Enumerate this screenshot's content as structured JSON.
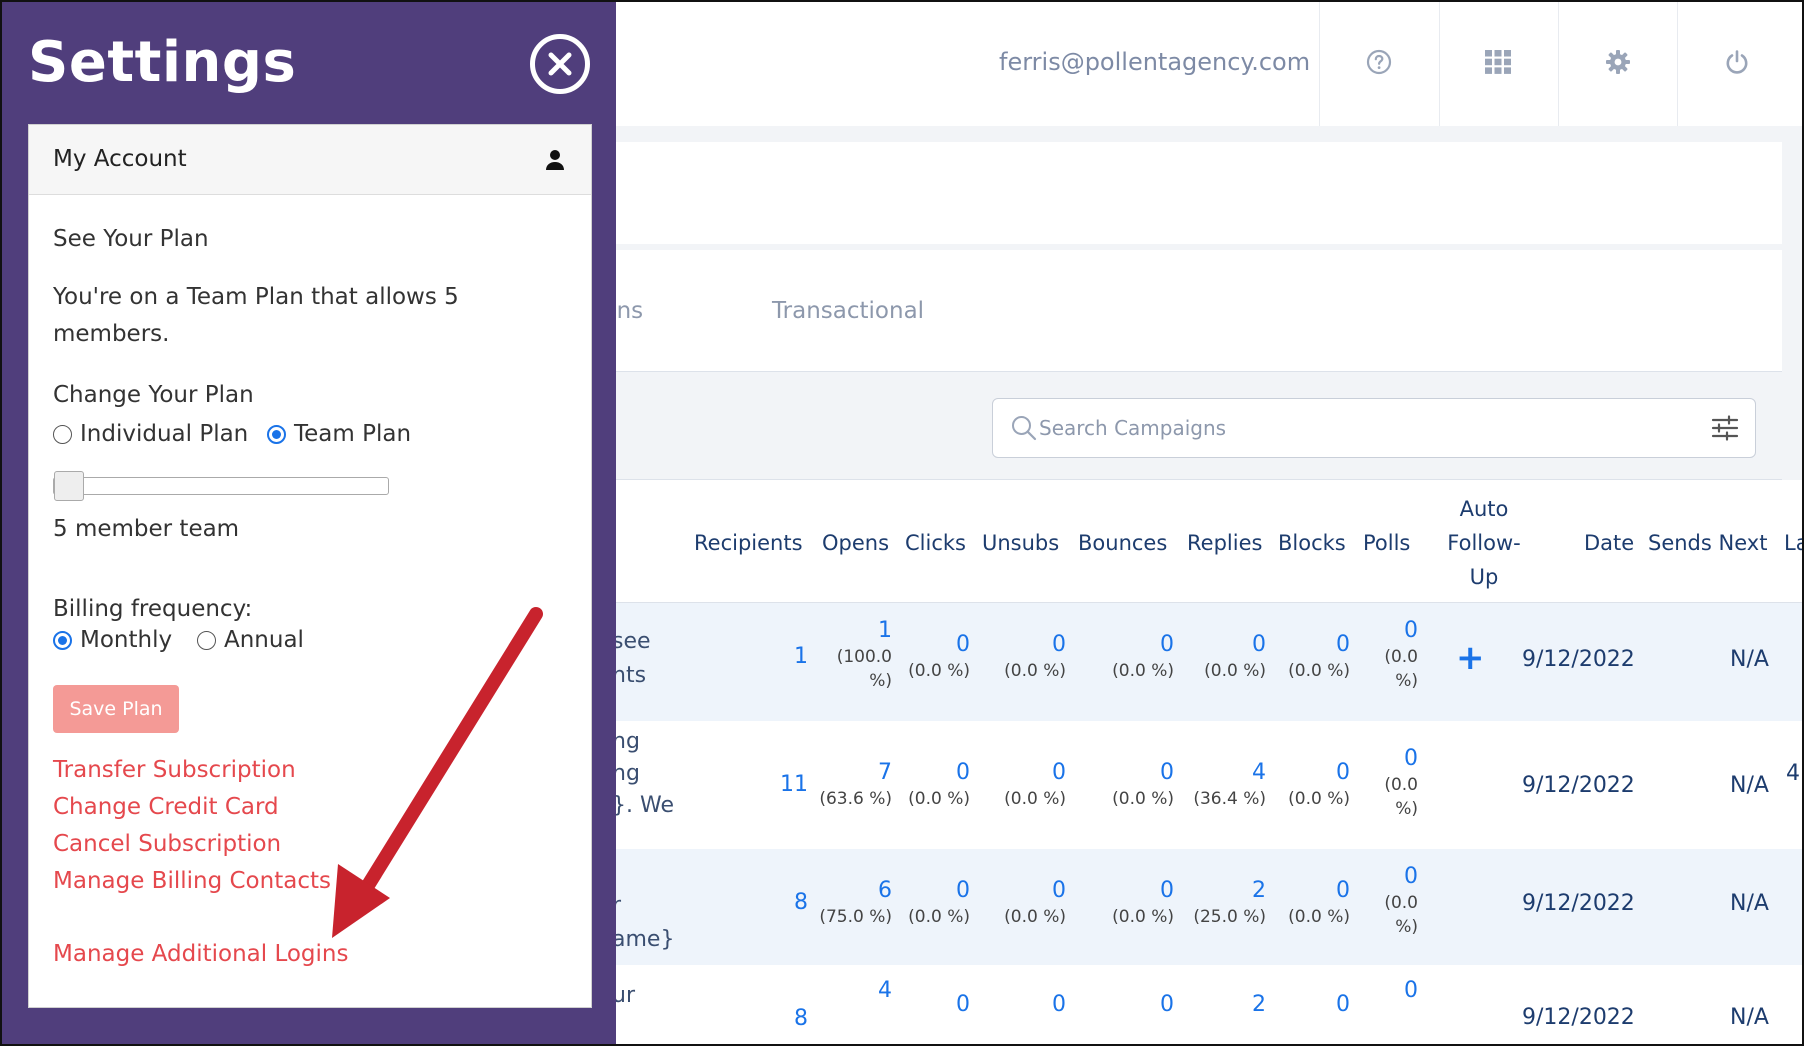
{
  "header": {
    "user_email": "ferris@pollentagency.com",
    "icons": [
      "help-icon",
      "apps-grid-icon",
      "gear-icon",
      "power-icon"
    ]
  },
  "tabs": {
    "partial_label": "gns",
    "transactional_label": "Transactional"
  },
  "search": {
    "placeholder": "Search Campaigns",
    "value": ""
  },
  "table": {
    "columns": {
      "recipients": "Recipients",
      "opens": "Opens",
      "clicks": "Clicks",
      "unsubs": "Unsubs",
      "bounces": "Bounces",
      "replies": "Replies",
      "blocks": "Blocks",
      "polls": "Polls",
      "auto_followup_1": "Auto",
      "auto_followup_2": "Follow-",
      "auto_followup_3": "Up",
      "date": "Date",
      "sends_next": "Sends Next",
      "last_partial": "La"
    },
    "rows": [
      {
        "frag": [
          "see",
          "nts"
        ],
        "recipients": "1",
        "opens": "1",
        "opens_pct_1": "(100.0",
        "opens_pct_2": "%)",
        "clicks": "0",
        "clicks_pct": "(0.0 %)",
        "unsubs": "0",
        "unsubs_pct": "(0.0 %)",
        "bounces": "0",
        "bounces_pct": "(0.0 %)",
        "replies": "0",
        "replies_pct": "(0.0 %)",
        "blocks": "0",
        "blocks_pct": "(0.0 %)",
        "polls": "0",
        "polls_pct_1": "(0.0",
        "polls_pct_2": "%)",
        "auto_followup": "+",
        "date": "9/12/2022",
        "sends_next": "N/A",
        "last": ""
      },
      {
        "frag": [
          "ng",
          "ng",
          "}. We"
        ],
        "recipients": "11",
        "opens": "7",
        "opens_pct": "(63.6 %)",
        "clicks": "0",
        "clicks_pct": "(0.0 %)",
        "unsubs": "0",
        "unsubs_pct": "(0.0 %)",
        "bounces": "0",
        "bounces_pct": "(0.0 %)",
        "replies": "4",
        "replies_pct": "(36.4 %)",
        "blocks": "0",
        "blocks_pct": "(0.0 %)",
        "polls": "0",
        "polls_pct_1": "(0.0",
        "polls_pct_2": "%)",
        "date": "9/12/2022",
        "sends_next": "N/A",
        "last": "4"
      },
      {
        "frag": [
          "r",
          "ame}"
        ],
        "recipients": "8",
        "opens": "6",
        "opens_pct": "(75.0 %)",
        "clicks": "0",
        "clicks_pct": "(0.0 %)",
        "unsubs": "0",
        "unsubs_pct": "(0.0 %)",
        "bounces": "0",
        "bounces_pct": "(0.0 %)",
        "replies": "2",
        "replies_pct": "(25.0 %)",
        "blocks": "0",
        "blocks_pct": "(0.0 %)",
        "polls": "0",
        "polls_pct_1": "(0.0",
        "polls_pct_2": "%)",
        "date": "9/12/2022",
        "sends_next": "N/A",
        "last": ""
      },
      {
        "frag": [
          "ur"
        ],
        "recipients": "8",
        "opens": "4",
        "clicks": "0",
        "unsubs": "0",
        "bounces": "0",
        "replies": "2",
        "blocks": "0",
        "polls": "0",
        "date": "9/12/2022",
        "sends_next": "N/A"
      }
    ]
  },
  "settings": {
    "title": "Settings",
    "account_header": "My Account",
    "see_plan": "See Your Plan",
    "plan_desc": "You're on a Team Plan that allows 5 members.",
    "change_plan": "Change Your Plan",
    "plan_options": [
      "Individual Plan",
      "Team Plan"
    ],
    "selected_plan": "Team Plan",
    "team_size": 5,
    "team_size_label": "5 member team",
    "billing_label": "Billing frequency:",
    "billing_options": [
      "Monthly",
      "Annual"
    ],
    "selected_billing": "Monthly",
    "save_label": "Save Plan",
    "links": {
      "transfer": "Transfer Subscription",
      "credit_card": "Change Credit Card",
      "cancel": "Cancel Subscription",
      "billing_contacts": "Manage Billing Contacts",
      "additional_logins": "Manage Additional Logins"
    }
  },
  "colors": {
    "settings_bg": "#503e7c",
    "link": "#e5484d",
    "save_button": "#f49a96",
    "accent_blue": "#1a73e8",
    "arrow": "#c8232d"
  }
}
